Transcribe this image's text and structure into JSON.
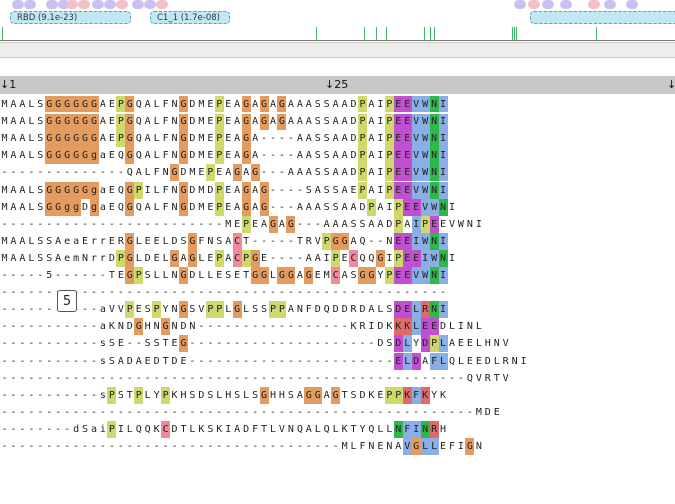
{
  "domains": [
    {
      "label": "RBD (9.1e-23)"
    },
    {
      "label": "C1_1 (1.7e-08)"
    },
    {
      "label": ""
    }
  ],
  "ruler": {
    "label_1": "↓1",
    "label_25": "↓25",
    "label_end": "↓"
  },
  "tooltip": {
    "value": "5"
  },
  "colors": {
    "orange": "#e49b5f",
    "yellow": "#cfd86a",
    "blue": "#8aaee6",
    "purple": "#c050d0",
    "green": "#2eb84a",
    "teal": "#2aa88a",
    "red": "#e06a6a",
    "pink": "#f08a9a"
  },
  "rows": [
    "MAALSGGGGGGAEPGQALFNGDMEPEAGAGAGAAASSAADPAIPEEVWNI",
    "MAALSGGGGGGAEPGQALFNGDMEPEAGAGAGAAASSAADPAIPEEVWNI",
    "MAALSGGGGGGAEPGQALFNGDMEPEAGA----AASSAADPAIPEEVWNI",
    "MAALSGGGGGgaEQGQALFNGDMEPEAGA----AASSAADPAIPEEVWNI",
    "--------------QALFNGDMEPEAGAG---AAASSAADPAIPEEVWNI",
    "MAALSGGGGGgaEQGPILFNGDMDPEAGAG----SASSAEPAIPEEVWNI",
    "MAALSGGggDgaEQGQALFNGDMEPEAGAG---AAASSAADPAIPEEVWNI",
    "-------------------------MEPEAGAG---AAASSAADPAIPEEVWNI",
    "MAALSSAeaErrERGLEELDSGFNSACT-----TRVPGGAQ--NEEIWNI",
    "MAALSSAemNrrDPGLDELGAGLEPACPGE----AAIPECQQGIPEEIWNI",
    "-----5------TEGPSLLNGDLLESETGGLGGAGEMCASGGYPEEVWNI",
    "--------------------------------------------------",
    "-----------aVVPESPYNGSVPPLGLSSPPANFDQDDRDALSDELRNI",
    "-----------aKNDGHNGNDN-----------------KRIDKKKLEEDLINL",
    "-----------sSE--SSTEG---------------------DSDLYDPLAEELHNV",
    "-----------sSADAEDTDE-----------------------ELDAFLQLEEDLRNI",
    "----------------------------------------------------QVRTV",
    "-----------sPSTPLYPKHSDSLHSLSGHHSAGGAGTSDKEPPKFKYK",
    "-----------------------------------------------------MDE",
    "--------dSaiPILQQKCDTLKSKIADFTLVNQALQLKTYQLLNFINRH",
    "--------------------------------------MLFNENAVGLLEFIGN"
  ]
}
